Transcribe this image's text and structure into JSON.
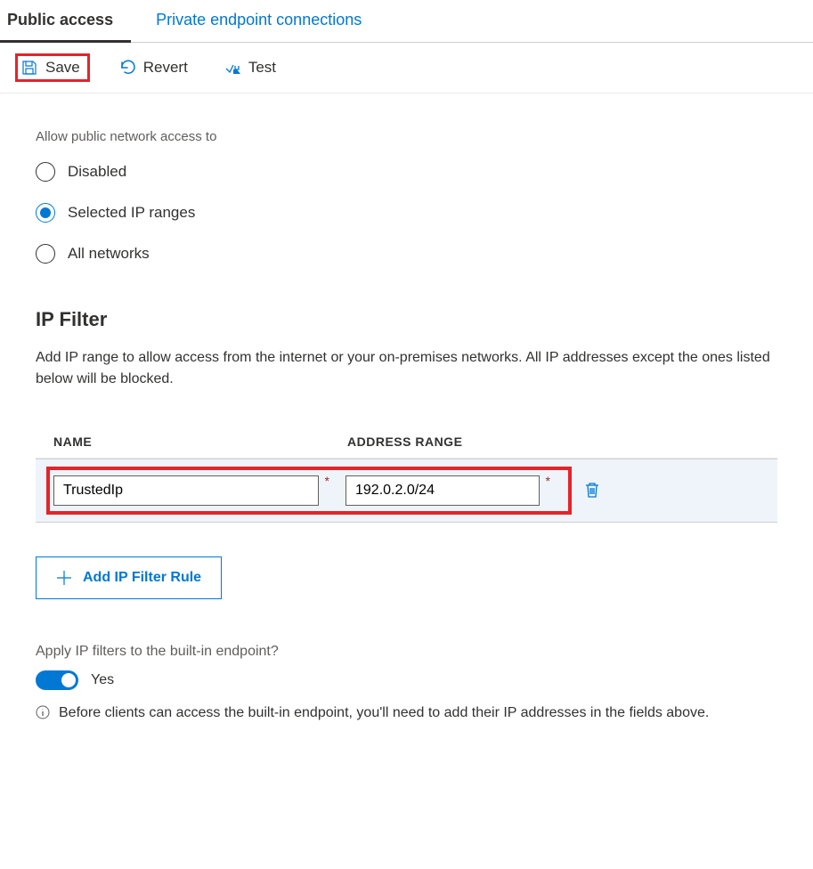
{
  "tabs": {
    "public": "Public access",
    "private": "Private endpoint connections"
  },
  "toolbar": {
    "save": "Save",
    "revert": "Revert",
    "test": "Test"
  },
  "access": {
    "label": "Allow public network access to",
    "options": {
      "disabled": "Disabled",
      "selected": "Selected IP ranges",
      "all": "All networks"
    }
  },
  "ipfilter": {
    "heading": "IP Filter",
    "description": "Add IP range to allow access from the internet or your on-premises networks. All IP addresses except the ones listed below will be blocked.",
    "columns": {
      "name": "NAME",
      "address": "ADDRESS RANGE"
    },
    "rows": [
      {
        "name": "TrustedIp",
        "address": "192.0.2.0/24"
      }
    ],
    "add_button": "Add IP Filter Rule"
  },
  "apply": {
    "label": "Apply IP filters to the built-in endpoint?",
    "toggle_text": "Yes",
    "note": "Before clients can access the built-in endpoint, you'll need to add their IP addresses in the fields above."
  }
}
